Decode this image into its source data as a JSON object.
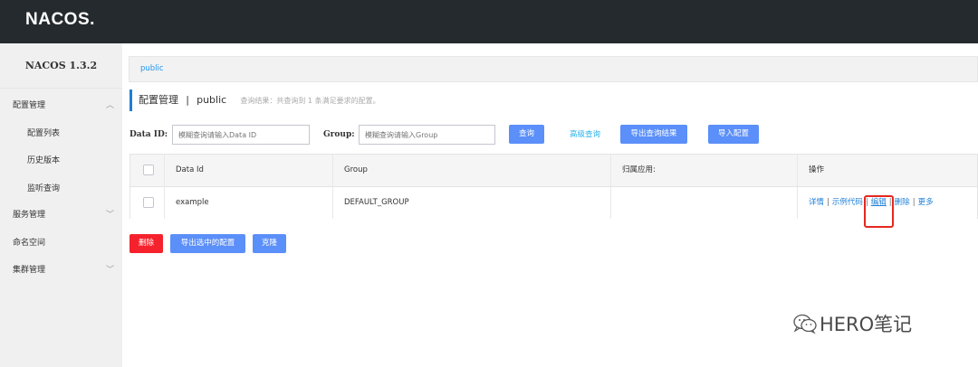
{
  "header": {
    "logo": "NACOS."
  },
  "sidebar": {
    "version": "NACOS 1.3.2",
    "items": [
      {
        "label": "配置管理",
        "chevron": "^"
      },
      {
        "label": "配置列表"
      },
      {
        "label": "历史版本"
      },
      {
        "label": "监听查询"
      },
      {
        "label": "服务管理",
        "chevron": "v"
      },
      {
        "label": "命名空间"
      },
      {
        "label": "集群管理",
        "chevron": "v"
      }
    ]
  },
  "main": {
    "breadcrumb": "public",
    "title": "配置管理",
    "title_sep": "|",
    "namespace": "public",
    "result_hint": "查询结果：共查询到 1 条满足要求的配置。",
    "search": {
      "dataid_label": "Data ID:",
      "dataid_placeholder": "模糊查询请输入Data ID",
      "group_label": "Group:",
      "group_placeholder": "模糊查询请输入Group",
      "query_btn": "查询",
      "advanced_link": "高级查询",
      "export_btn": "导出查询结果",
      "import_btn": "导入配置"
    },
    "table": {
      "headers": [
        "Data Id",
        "Group",
        "归属应用:",
        "操作"
      ],
      "rows": [
        {
          "data_id": "example",
          "group": "DEFAULT_GROUP",
          "app": ""
        }
      ],
      "ops": {
        "detail": "详情",
        "sample": "示例代码",
        "edit": "编辑",
        "delete": "删除",
        "more": "更多",
        "sep": "|"
      }
    },
    "bulk": {
      "delete_btn": "删除",
      "export_btn": "导出选中的配置",
      "clone_btn": "克隆"
    }
  },
  "watermark": {
    "text": "HERO笔记"
  },
  "colors": {
    "primary": "#5b8ff9",
    "danger": "#f5222d",
    "topbar": "#252a2f",
    "highlight": "#e5271f"
  }
}
